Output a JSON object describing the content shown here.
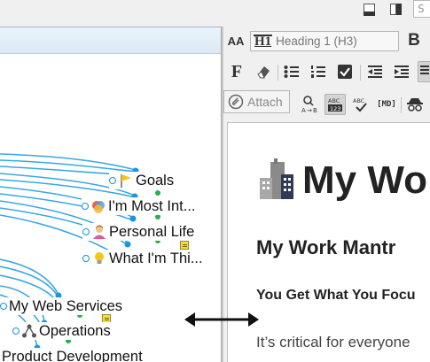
{
  "topbar": {
    "search_placeholder": "S",
    "icons": [
      "layout-bottom-icon",
      "layout-split-icon"
    ]
  },
  "mindmap": {
    "topics": [
      {
        "label": "Goals",
        "icon": "flag-icon",
        "has_note": false
      },
      {
        "label": "I'm Most Int...",
        "icon": "colored-circles-icon",
        "has_note": false
      },
      {
        "label": "Personal Life",
        "icon": "person-icon",
        "has_note": true
      },
      {
        "label": "What I'm Thi...",
        "icon": "lightbulb-icon",
        "has_note": false
      },
      {
        "label": "My Web Services",
        "icon": "",
        "has_note": true
      },
      {
        "label": "Operations",
        "icon": "network-icon",
        "has_note": false
      },
      {
        "label": "Product Development",
        "icon": "",
        "has_note": false
      }
    ],
    "colors": {
      "connector": "#3aa7e2",
      "node_dot": "#1a96dc",
      "green_dot": "#22b14c"
    }
  },
  "editor": {
    "heading_font_label": "AA",
    "heading_select_icon": "H1",
    "heading_select_value": "Heading 1 (H3)",
    "bold_label": "B",
    "font_label": "F",
    "attach_label": "Attach",
    "markdown_label": "[MD]",
    "document": {
      "title": "My Wo",
      "title_icon": "office-building-icon",
      "heading2": "My Work Mantr",
      "heading3": "You Get What You Focu",
      "paragraph": "It’s critical for everyone"
    }
  }
}
